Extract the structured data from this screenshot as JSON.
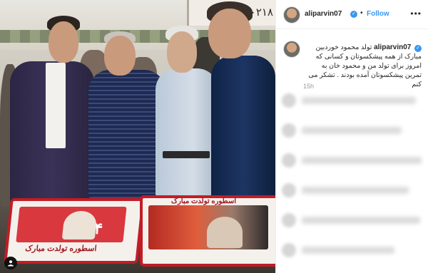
{
  "post": {
    "username": "aliparvin07",
    "verified_mark": "✓",
    "follow_label": "Follow",
    "separator": "•",
    "more_label": "•••",
    "caption_text": "تولد محمود خوردبین مبارک از همه پیشکسوتان و کسانی که امروز برای تولد من و محمود خان به تمرین پیشکسوتان آمده بودند . تشکر می کنم",
    "time_ago": "15h"
  },
  "photo": {
    "sign_text": "-۹۰ ۰۲۱۸",
    "cake_left_text": "اسطوره تولدت مبارک",
    "cake_right_text": "اسطوره تولدت مبارک",
    "cake_red_number": "۷۴"
  },
  "colors": {
    "link_blue": "#3897f0",
    "cake_red": "#c11d26",
    "text_dark": "#262626",
    "muted": "#999999"
  },
  "icons": {
    "verified": "verified-badge-icon",
    "user_tag": "user-tag-icon",
    "more": "more-options-icon"
  }
}
